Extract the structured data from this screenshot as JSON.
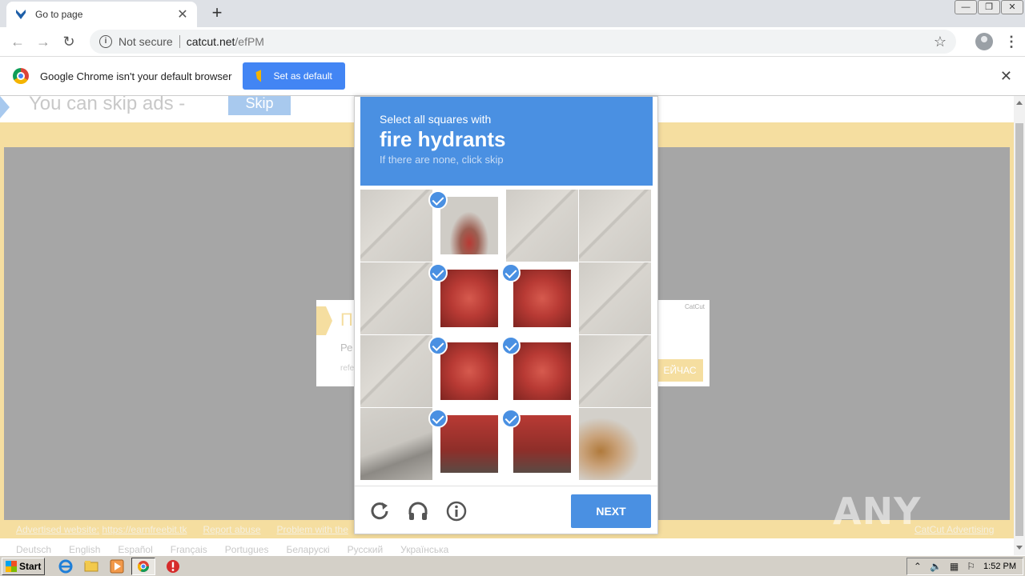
{
  "browser": {
    "tab_title": "Go to page",
    "tab_close": "✕",
    "new_tab": "+",
    "window_buttons": [
      "—",
      "❐",
      "✕"
    ],
    "security_label": "Not secure",
    "url_domain": "catcut.net",
    "url_path": "/efPM"
  },
  "infobar": {
    "message": "Google Chrome isn't your default browser",
    "button_label": "Set as default",
    "close": "✕"
  },
  "page": {
    "skip_text": "You can skip ads  -",
    "skip_button": "Skip",
    "ad_left_title": "П",
    "ad_left_line": "Ре",
    "ad_left_small": "refe",
    "ad_right_brand": "CatCut",
    "ad_right_button": "ЕЙЧАС",
    "advertised_label": "Advertised website:",
    "advertised_link": "https://earnfreebit.tk",
    "report_abuse": "Report abuse",
    "problem_link": "Problem with the",
    "catcut_advertising": "CatCut Advertising",
    "languages": [
      "Deutsch",
      "English",
      "Español",
      "Français",
      "Portugues",
      "Беларускі",
      "Русский",
      "Українська"
    ]
  },
  "captcha": {
    "instruction": "Select all squares with",
    "target": "fire hydrants",
    "hint": "If there are none, click skip",
    "next_button": "NEXT",
    "tiles": [
      {
        "selected": false,
        "img": "pavement"
      },
      {
        "selected": true,
        "img": "hydrant-top"
      },
      {
        "selected": false,
        "img": "pavement"
      },
      {
        "selected": false,
        "img": "pavement"
      },
      {
        "selected": false,
        "img": "pavement"
      },
      {
        "selected": true,
        "img": "hydrant"
      },
      {
        "selected": true,
        "img": "hydrant"
      },
      {
        "selected": false,
        "img": "pavement"
      },
      {
        "selected": false,
        "img": "pavement"
      },
      {
        "selected": true,
        "img": "hydrant"
      },
      {
        "selected": true,
        "img": "hydrant"
      },
      {
        "selected": false,
        "img": "pavement"
      },
      {
        "selected": false,
        "img": "pavement-shadow"
      },
      {
        "selected": true,
        "img": "hydrant-base"
      },
      {
        "selected": true,
        "img": "hydrant-base"
      },
      {
        "selected": false,
        "img": "pavement-stain"
      }
    ]
  },
  "watermark": "ANY RUN",
  "taskbar": {
    "start_label": "Start",
    "clock": "1:52 PM"
  },
  "colors": {
    "captcha_blue": "#4a90e2",
    "chrome_blue": "#4285f4",
    "page_yellow": "#f5dea0",
    "hydrant_red": "#b83a34"
  }
}
